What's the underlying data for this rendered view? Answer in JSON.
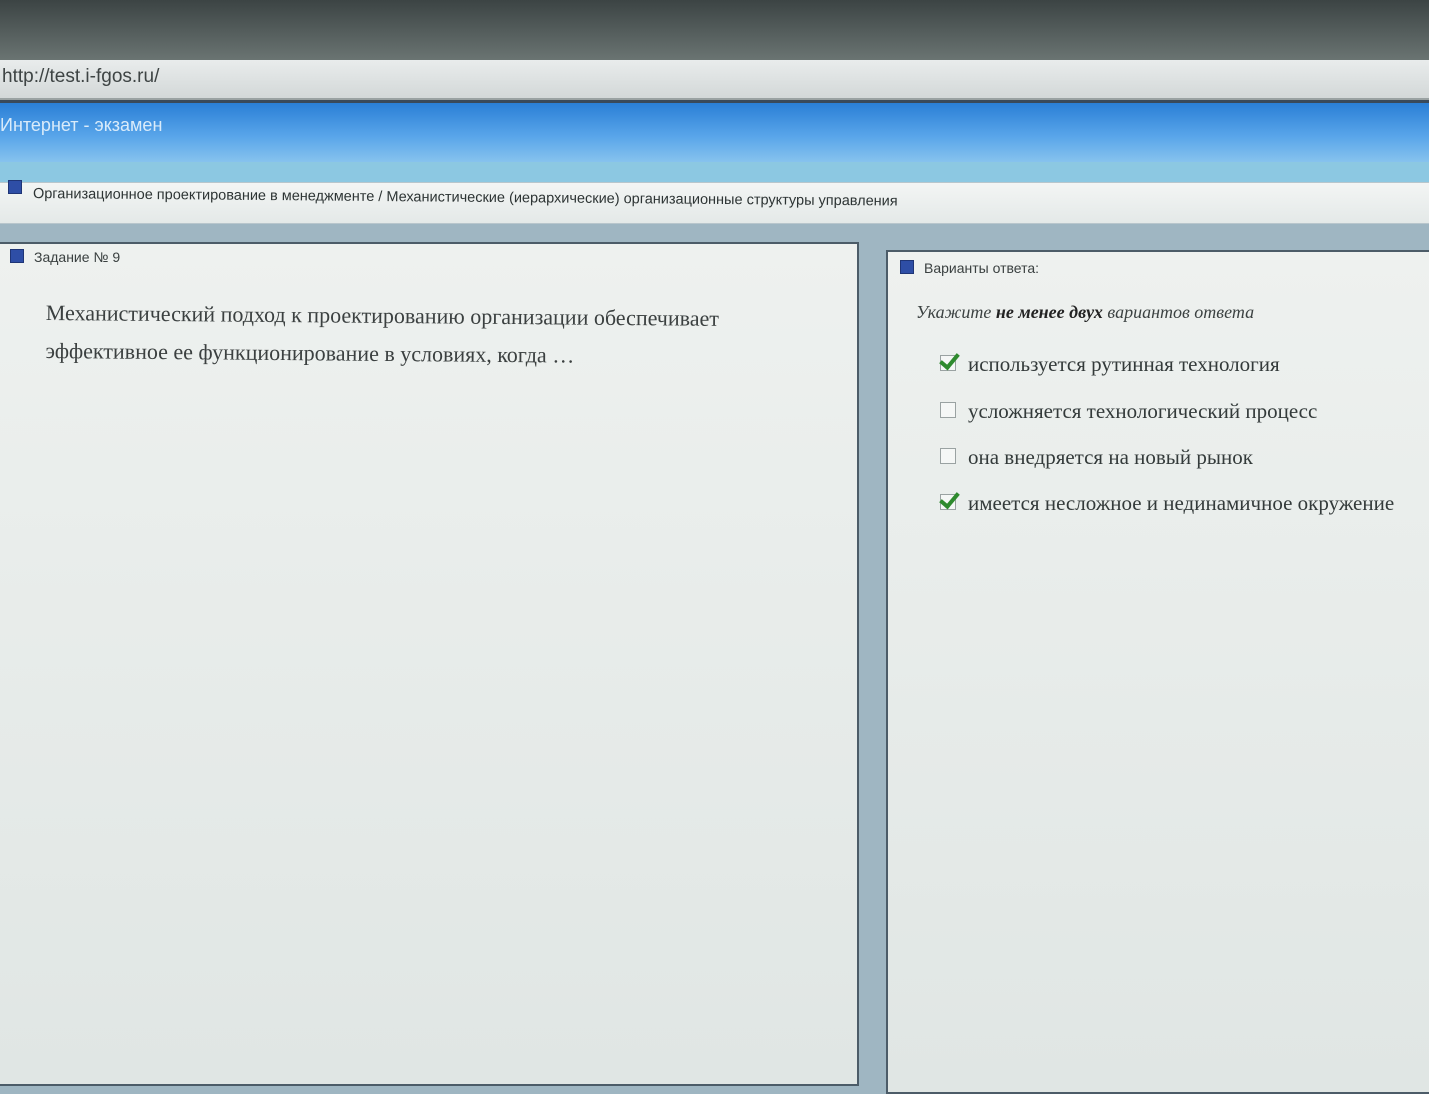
{
  "browser": {
    "url": "http://test.i-fgos.ru/"
  },
  "app": {
    "title": "Интернет - экзамен"
  },
  "breadcrumb": {
    "text": "Организационное проектирование в менеджменте / Механистические (иерархические) организационные структуры управления"
  },
  "task": {
    "heading": "Задание № 9",
    "question": "Механистический подход к проектированию организации обеспечивает эффективное ее функционирование в условиях, когда …"
  },
  "answers": {
    "heading": "Варианты ответа:",
    "instruction_prefix": "Укажите ",
    "instruction_bold": "не менее двух",
    "instruction_suffix": " вариантов ответа",
    "options": [
      {
        "label": "используется рутинная технология",
        "checked": true
      },
      {
        "label": "усложняется технологический процесс",
        "checked": false
      },
      {
        "label": "она внедряется на новый рынок",
        "checked": false
      },
      {
        "label": "имеется несложное и нединамичное окружение",
        "checked": true
      }
    ]
  },
  "colors": {
    "header_blue": "#2a7fd6",
    "checkmark_green": "#2e8a2e"
  }
}
